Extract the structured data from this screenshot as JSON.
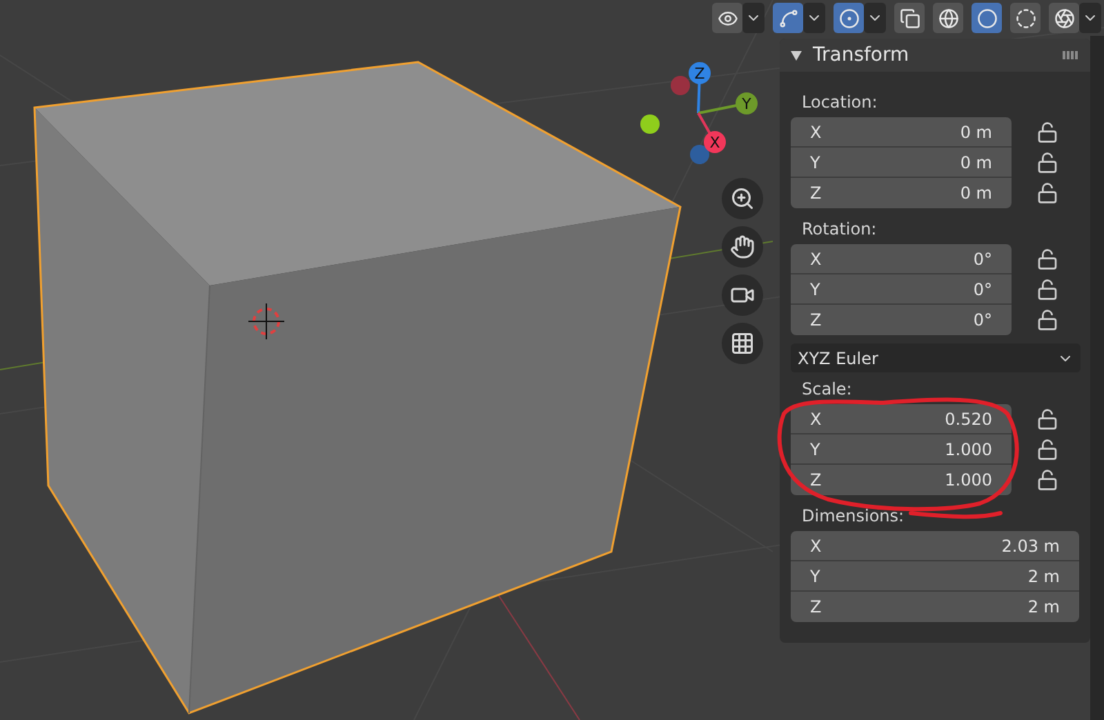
{
  "toolbar": [
    {
      "kind": "visibility",
      "selected": false,
      "caret": true
    },
    {
      "kind": "gizmo",
      "selected": true,
      "caret": true
    },
    {
      "kind": "overlay",
      "selected": true,
      "caret": true
    },
    {
      "kind": "xray",
      "selected": false,
      "caret": false
    },
    {
      "kind": "wireframe",
      "selected": false,
      "caret": false
    },
    {
      "kind": "solid",
      "selected": true,
      "caret": false
    },
    {
      "kind": "material",
      "selected": false,
      "caret": false
    },
    {
      "kind": "rendered",
      "selected": false,
      "caret": true
    }
  ],
  "gizmo": {
    "axes": [
      "X",
      "Y",
      "Z"
    ]
  },
  "nav_buttons": [
    {
      "kind": "zoom"
    },
    {
      "kind": "pan"
    },
    {
      "kind": "camera"
    },
    {
      "kind": "ortho"
    }
  ],
  "panel": {
    "title": "Transform",
    "expanded": true,
    "sections": [
      {
        "kind": "fields",
        "label": "Location:",
        "rows": [
          {
            "axis": "X",
            "value": "0 m",
            "locked": false
          },
          {
            "axis": "Y",
            "value": "0 m",
            "locked": false
          },
          {
            "axis": "Z",
            "value": "0 m",
            "locked": false
          }
        ]
      },
      {
        "kind": "fields",
        "label": "Rotation:",
        "rows": [
          {
            "axis": "X",
            "value": "0°",
            "locked": false
          },
          {
            "axis": "Y",
            "value": "0°",
            "locked": false
          },
          {
            "axis": "Z",
            "value": "0°",
            "locked": false
          }
        ]
      },
      {
        "kind": "dropdown",
        "value": "XYZ Euler"
      },
      {
        "kind": "fields",
        "label": "Scale:",
        "rows": [
          {
            "axis": "X",
            "value": "0.520",
            "locked": false
          },
          {
            "axis": "Y",
            "value": "1.000",
            "locked": false
          },
          {
            "axis": "Z",
            "value": "1.000",
            "locked": false
          }
        ]
      },
      {
        "kind": "fields",
        "label": "Dimensions:",
        "rows": [
          {
            "axis": "X",
            "value": "2.03 m"
          },
          {
            "axis": "Y",
            "value": "2 m"
          },
          {
            "axis": "Z",
            "value": "2 m"
          }
        ]
      }
    ]
  }
}
